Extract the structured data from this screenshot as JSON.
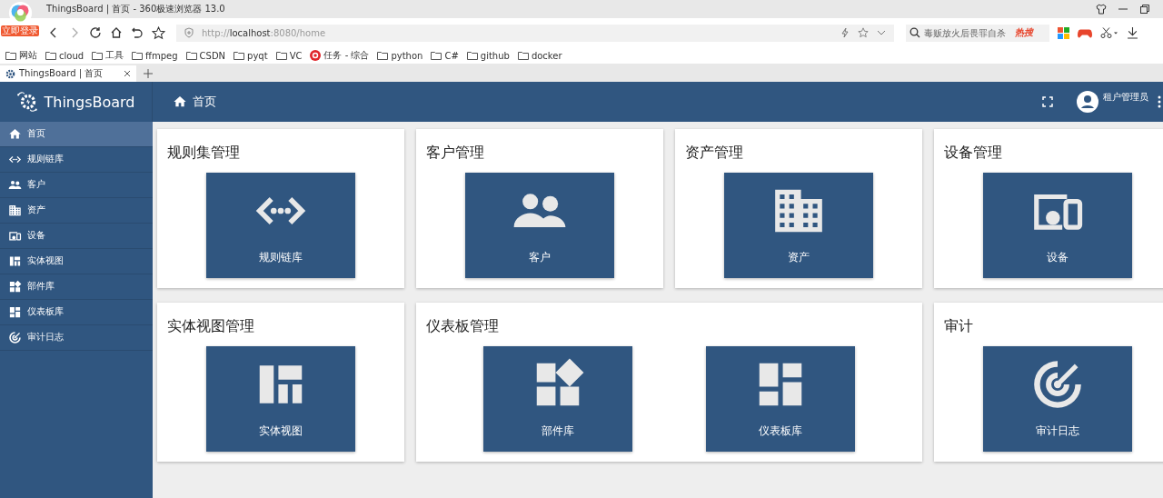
{
  "browser": {
    "title": "ThingsBoard | 首页 - 360极速浏览器 13.0",
    "login_badge": "立即登录",
    "url_scheme": "http://",
    "url_host": "localhost",
    "url_rest": ":8080/home",
    "search_placeholder": "毒贩放火后畏罪自杀",
    "hot_label": "热搜",
    "bookmarks": [
      {
        "label": "网站",
        "kind": "folder"
      },
      {
        "label": "cloud",
        "kind": "folder"
      },
      {
        "label": "工具",
        "kind": "folder"
      },
      {
        "label": "ffmpeg",
        "kind": "folder"
      },
      {
        "label": "CSDN",
        "kind": "folder"
      },
      {
        "label": "pyqt",
        "kind": "folder"
      },
      {
        "label": "VC",
        "kind": "folder"
      },
      {
        "label": "任务 - 综合",
        "kind": "site"
      },
      {
        "label": "python",
        "kind": "folder"
      },
      {
        "label": "C#",
        "kind": "folder"
      },
      {
        "label": "github",
        "kind": "folder"
      },
      {
        "label": "docker",
        "kind": "folder"
      }
    ],
    "tabs": [
      {
        "label": "ThingsBoard | 首页",
        "selected": true
      }
    ]
  },
  "app": {
    "brand": "ThingsBoard",
    "page_title": "首页",
    "user": "租户管理员",
    "sidebar": [
      {
        "label": "首页",
        "kind": "home",
        "selected": true
      },
      {
        "label": "规则链库",
        "kind": "rule",
        "selected": false
      },
      {
        "label": "客户",
        "kind": "customer",
        "selected": false
      },
      {
        "label": "资产",
        "kind": "asset",
        "selected": false
      },
      {
        "label": "设备",
        "kind": "device",
        "selected": false
      },
      {
        "label": "实体视图",
        "kind": "entity",
        "selected": false
      },
      {
        "label": "部件库",
        "kind": "widget",
        "selected": false
      },
      {
        "label": "仪表板库",
        "kind": "dashboard",
        "selected": false
      },
      {
        "label": "审计日志",
        "kind": "audit",
        "selected": false
      }
    ],
    "sections": [
      {
        "title": "规则集管理",
        "tiles": [
          {
            "label": "规则链库",
            "kind": "rule"
          }
        ]
      },
      {
        "title": "客户管理",
        "tiles": [
          {
            "label": "客户",
            "kind": "customer"
          }
        ]
      },
      {
        "title": "资产管理",
        "tiles": [
          {
            "label": "资产",
            "kind": "asset"
          }
        ]
      },
      {
        "title": "设备管理",
        "tiles": [
          {
            "label": "设备",
            "kind": "device"
          }
        ]
      },
      {
        "title": "实体视图管理",
        "tiles": [
          {
            "label": "实体视图",
            "kind": "entity"
          }
        ]
      },
      {
        "title": "仪表板管理",
        "tiles": [
          {
            "label": "部件库",
            "kind": "widget"
          },
          {
            "label": "仪表板库",
            "kind": "dashboard"
          }
        ]
      },
      {
        "title": "审计",
        "tiles": [
          {
            "label": "审计日志",
            "kind": "audit"
          }
        ]
      }
    ]
  }
}
